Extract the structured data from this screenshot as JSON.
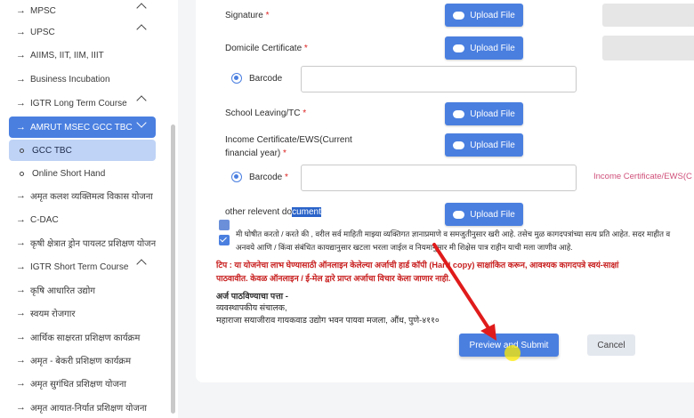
{
  "sidebar": {
    "items": [
      {
        "label": "MPSC",
        "type": "group"
      },
      {
        "label": "UPSC",
        "type": "group"
      },
      {
        "label": "AIIMS, IIT, IIM, IIIT",
        "type": "link"
      },
      {
        "label": "Business Incubation",
        "type": "link"
      },
      {
        "label": "IGTR Long Term Course",
        "type": "group"
      },
      {
        "label": "AMRUT MSEC GCC TBC",
        "type": "group-open"
      },
      {
        "label": "GCC TBC",
        "type": "child-active"
      },
      {
        "label": "Online Short Hand",
        "type": "child"
      },
      {
        "label": "अमृत कलश व्यक्तिमत्व विकास योजना",
        "type": "link"
      },
      {
        "label": "C-DAC",
        "type": "link"
      },
      {
        "label": "कृषी क्षेत्रात ड्रोन पायलट प्रशिक्षण योजना",
        "type": "link"
      },
      {
        "label": "IGTR Short Term Course",
        "type": "group"
      },
      {
        "label": "कृषि आधारित उद्योग",
        "type": "link"
      },
      {
        "label": "स्वयम रोजगार",
        "type": "link"
      },
      {
        "label": "आर्थिक साक्षरता प्रशिक्षण कार्यक्रम",
        "type": "link"
      },
      {
        "label": "अमृत - बेकरी प्रशिक्षण कार्यक्रम",
        "type": "link"
      },
      {
        "label": "अमृत सुगंधित प्रशिक्षण योजना",
        "type": "link"
      },
      {
        "label": "अमृत आयात-निर्यात प्रशिक्षण योजना",
        "type": "link"
      }
    ]
  },
  "form": {
    "signature_label": "Signature",
    "domicile_label": "Domicile Certificate",
    "barcode_label": "Barcode",
    "school_leaving_label": "School Leaving/TC",
    "income_label_line1": "Income Certificate/EWS(Current",
    "income_label_line2": "financial year)",
    "barcode_required_label": "Barcode",
    "other_doc_prefix": "other relevent do",
    "other_doc_selected": "cument",
    "upload_label": "Upload File",
    "required_mark": "*",
    "right_box_text": "d",
    "income_right_text": "Income Certificate/EWS(C"
  },
  "declaration": {
    "line1": "मी घोषीत करतो / करते की , वरील सर्व माहिती माझ्या व्यक्तिगत ज्ञानाप्रमाणे व समजुतीनुसार खरी आहे. तसेच मुळ कागदपत्रांच्या सत्य प्रति आहेत. सदर माहीत व",
    "line2": "अनवये आणि / किंवा संबंधित कायद्यानुसार खटला भरला जाईल व नियमानुसार मी शिक्षेस पात्र राहीन याची मला जाणीव आहे."
  },
  "note": {
    "line1": "टिप :  या योजनेचा लाभ घेण्यासाठी ऑनलाइन केलेल्या अर्जाची हार्ड कॉपी (Hard copy) साक्षांकित करून, आवश्यक कागदपत्रे स्वयं-साक्षां",
    "line2": "पाठवावीत. केवळ ऑनलाइन / ई-मेल द्वारे प्राप्त अर्जाचा विचार केला जाणार नाही."
  },
  "address": {
    "heading": "अर्ज पाठविण्याचा पत्ता -",
    "line1": "व्यवस्थापकीय संचालक,",
    "line2": "महाराजा सयाजीराव गायकवाड उद्योग भवन पायवा मजला, औंध, पुणे-४११०"
  },
  "actions": {
    "preview_label": "Preview and Submit",
    "cancel_label": "Cancel"
  },
  "colors": {
    "accent": "#4a7fe0",
    "note_red": "#c81e1e",
    "annotation_arrow": "#e01b1b"
  }
}
